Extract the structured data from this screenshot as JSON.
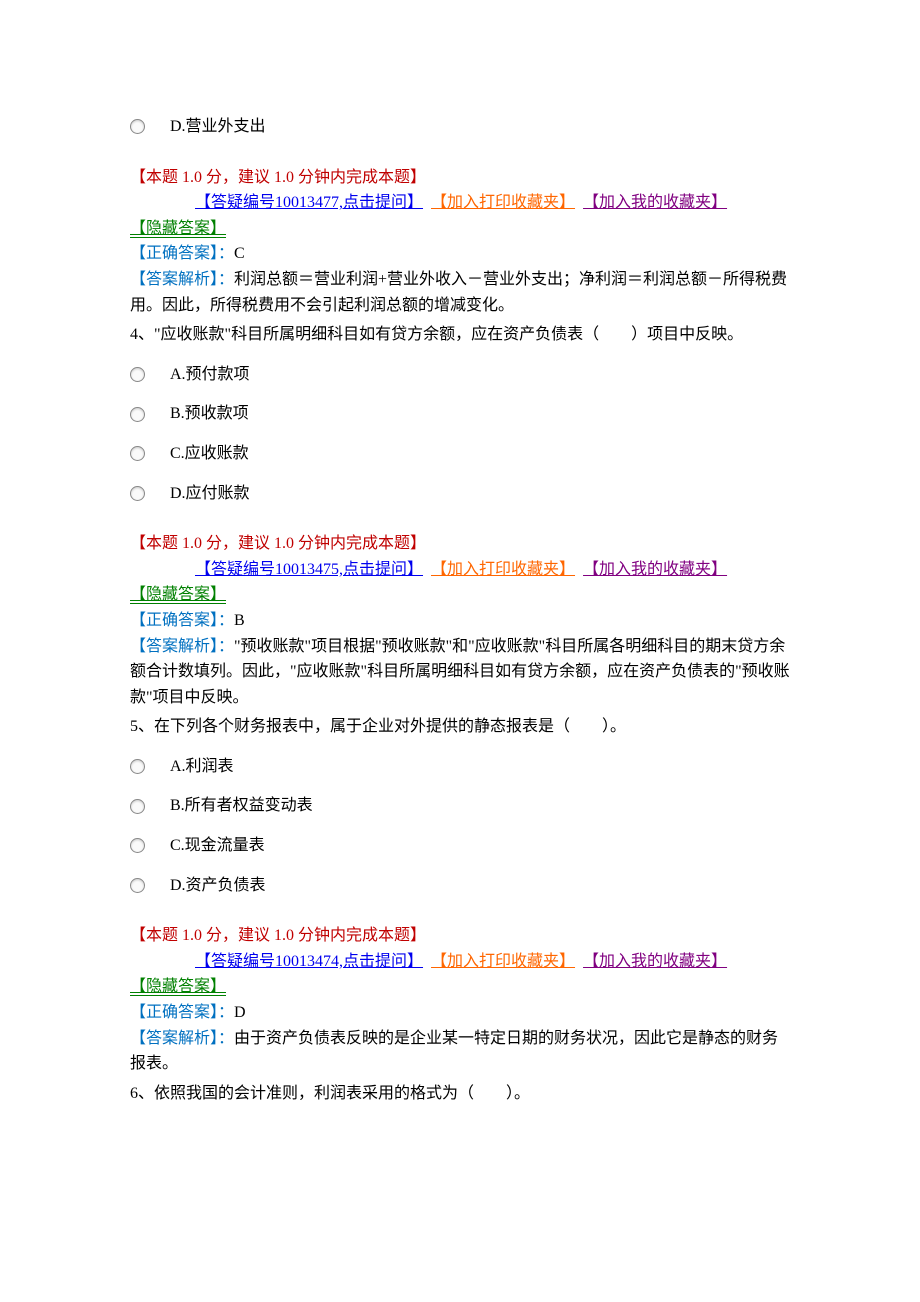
{
  "topOption": {
    "label": "D.营业外支出"
  },
  "meta": {
    "scoreLine": "【本题 1.0 分，建议 1.0 分钟内完成本题】",
    "hideAnswer": "【隐藏答案】 ",
    "correctLabel": "【正确答案】：",
    "analysisLabel": "【答案解析】："
  },
  "links": {
    "addPrint": "【加入打印收藏夹】",
    "addMy": "【加入我的收藏夹】"
  },
  "q3": {
    "qaLink": "【答疑编号10013477,点击提问】",
    "correct": "C",
    "analysis": "利润总额＝营业利润+营业外收入－营业外支出；净利润＝利润总额－所得税费用。因此，所得税费用不会引起利润总额的增减变化。"
  },
  "q4": {
    "stem": "4、\"应收账款\"科目所属明细科目如有贷方余额，应在资产负债表（　　）项目中反映。",
    "options": {
      "a": "A.预付款项",
      "b": "B.预收款项",
      "c": "C.应收账款",
      "d": "D.应付账款"
    },
    "qaLink": "【答疑编号10013475,点击提问】",
    "correct": "B",
    "analysis": "\"预收账款\"项目根据\"预收账款\"和\"应收账款\"科目所属各明细科目的期末贷方余额合计数填列。因此，\"应收账款\"科目所属明细科目如有贷方余额，应在资产负债表的\"预收账款\"项目中反映。"
  },
  "q5": {
    "stem": "5、在下列各个财务报表中，属于企业对外提供的静态报表是（　　）。",
    "options": {
      "a": "A.利润表",
      "b": "B.所有者权益变动表",
      "c": "C.现金流量表",
      "d": "D.资产负债表"
    },
    "qaLink": "【答疑编号10013474,点击提问】",
    "correct": "D",
    "analysis": "由于资产负债表反映的是企业某一特定日期的财务状况，因此它是静态的财务报表。"
  },
  "q6": {
    "stem": "6、依照我国的会计准则，利润表采用的格式为（　　）。"
  }
}
